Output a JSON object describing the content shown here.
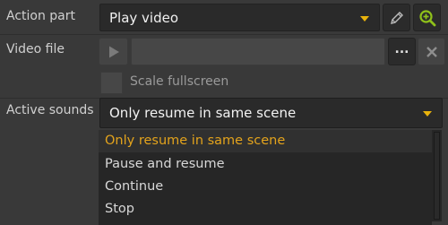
{
  "form": {
    "action_part": {
      "label": "Action part",
      "value": "Play video"
    },
    "video_file": {
      "label": "Video file",
      "value": ""
    },
    "scale_fullscreen": {
      "label": "Scale fullscreen",
      "checked": false
    },
    "active_sounds": {
      "label": "Active sounds",
      "value": "Only resume in same scene",
      "options": [
        "Only resume in same scene",
        "Pause and resume",
        "Continue",
        "Stop"
      ],
      "selected_index": 0
    }
  },
  "buttons": {
    "browse_label": "...",
    "edit_icon": "pencil-icon",
    "zoom_icon": "zoom-in-icon",
    "play_icon": "play-icon",
    "clear_icon": "close-icon"
  },
  "colors": {
    "accent": "#e9b30c",
    "selected_text": "#e3a31c",
    "zoom_green": "#8fc11a",
    "background": "#393939"
  }
}
